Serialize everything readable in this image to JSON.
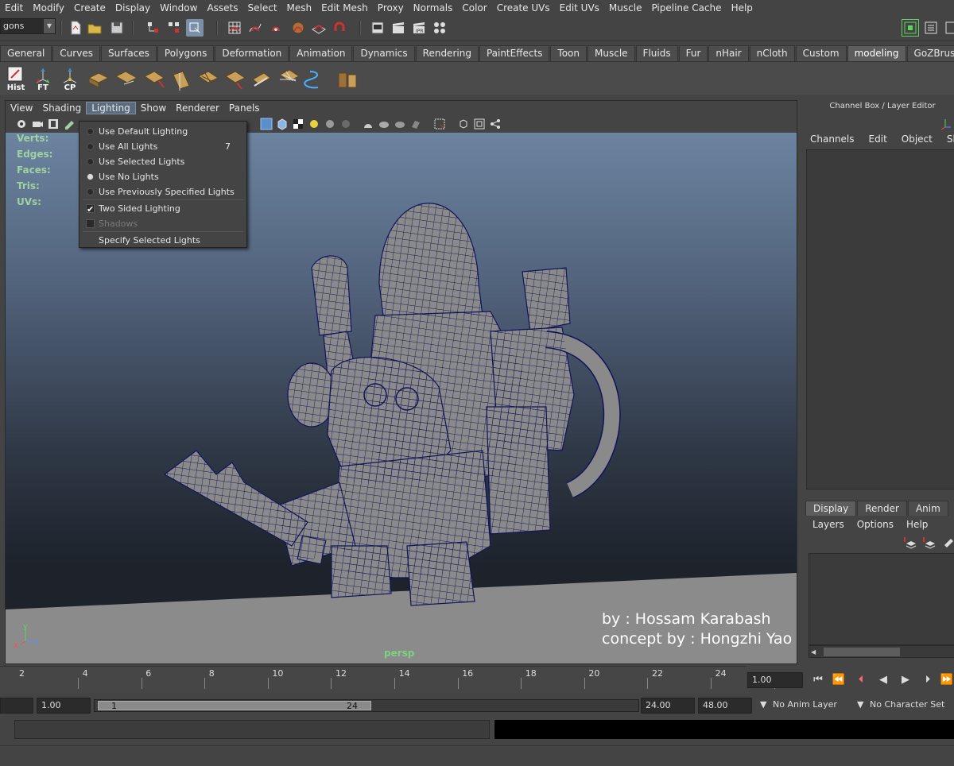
{
  "menubar": [
    "Edit",
    "Modify",
    "Create",
    "Display",
    "Window",
    "Assets",
    "Select",
    "Mesh",
    "Edit Mesh",
    "Proxy",
    "Normals",
    "Color",
    "Create UVs",
    "Edit UVs",
    "Muscle",
    "Pipeline Cache",
    "Help"
  ],
  "mode_selector": {
    "value": "gons"
  },
  "shelf_tabs": [
    "General",
    "Curves",
    "Surfaces",
    "Polygons",
    "Deformation",
    "Animation",
    "Dynamics",
    "Rendering",
    "PaintEffects",
    "Toon",
    "Muscle",
    "Fluids",
    "Fur",
    "nHair",
    "nCloth",
    "Custom",
    "modeling",
    "GoZBrush"
  ],
  "shelf_active": "modeling",
  "shelf_buttons": [
    "Hist",
    "FT",
    "CP"
  ],
  "viewport_menu": [
    "View",
    "Shading",
    "Lighting",
    "Show",
    "Renderer",
    "Panels"
  ],
  "viewport_menu_open": "Lighting",
  "hud": [
    "Verts:",
    "Edges:",
    "Faces:",
    "Tris:",
    "UVs:"
  ],
  "lighting_menu": {
    "items": [
      {
        "label": "Use Default Lighting",
        "kind": "radio",
        "selected": false
      },
      {
        "label": "Use All Lights",
        "kind": "radio",
        "selected": false,
        "shortcut": "7"
      },
      {
        "label": "Use Selected Lights",
        "kind": "radio",
        "selected": false
      },
      {
        "label": "Use No Lights",
        "kind": "radio",
        "selected": true
      },
      {
        "label": "Use Previously Specified Lights",
        "kind": "radio",
        "selected": false
      },
      {
        "label": "Two Sided Lighting",
        "kind": "check",
        "checked": true
      },
      {
        "label": "Shadows",
        "kind": "check",
        "checked": false,
        "disabled": true
      },
      {
        "label": "Specify Selected Lights",
        "kind": "command"
      }
    ]
  },
  "credit": {
    "line1": "by : Hossam Karabash",
    "line2": "concept by : Hongzhi Yao"
  },
  "camera_name": "persp",
  "axis": {
    "x": "x",
    "y": "y",
    "z": "z"
  },
  "channel_box": {
    "title": "Channel Box / Layer Editor",
    "menu": [
      "Channels",
      "Edit",
      "Object",
      "Show"
    ]
  },
  "layer_editor": {
    "tabs": [
      "Display",
      "Render",
      "Anim"
    ],
    "active_tab": "Display",
    "menu": [
      "Layers",
      "Options",
      "Help"
    ]
  },
  "timeline": {
    "ticks": [
      "2",
      "4",
      "6",
      "8",
      "10",
      "12",
      "14",
      "16",
      "18",
      "20",
      "22",
      "24"
    ],
    "current_frame": "1.00"
  },
  "range": {
    "start_field": "1.00",
    "slider_start": "1",
    "slider_end": "24",
    "end_field": "24.00",
    "total_end": "48.00",
    "anim_layer": "No Anim Layer",
    "character_set": "No Character Set"
  },
  "colors": {
    "accent": "#5b6b7e",
    "hud_green": "#9fd29f",
    "viewport_top": "#6b84a0",
    "viewport_bottom": "#1d222b"
  }
}
